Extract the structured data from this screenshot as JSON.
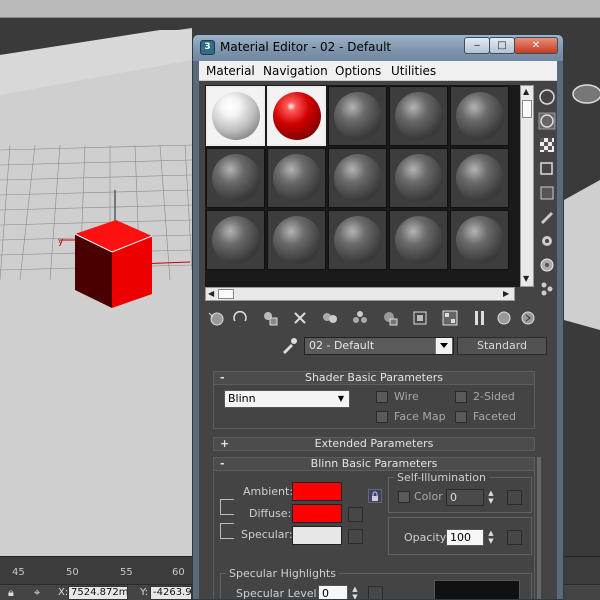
{
  "window": {
    "title": "Material Editor - 02 - Default"
  },
  "menu": [
    "Material",
    "Navigation",
    "Options",
    "Utilities"
  ],
  "material": {
    "name": "02 - Default",
    "type": "Standard"
  },
  "rollouts": {
    "shader_basic": {
      "title": "Shader Basic Parameters",
      "sign": "-",
      "shader": "Blinn",
      "wire_label": "Wire",
      "two_sided_label": "2-Sided",
      "face_map_label": "Face Map",
      "faceted_label": "Faceted"
    },
    "extended": {
      "title": "Extended Parameters",
      "sign": "+"
    },
    "blinn_basic": {
      "title": "Blinn Basic Parameters",
      "sign": "-",
      "ambient_label": "Ambient:",
      "diffuse_label": "Diffuse:",
      "specular_label": "Specular:",
      "ambient_color": "#ff0000",
      "diffuse_color": "#ff0000",
      "specular_color": "#e6e6e6",
      "self_illum_title": "Self-Illumination",
      "color_label": "Color",
      "self_illum_value": "0",
      "opacity_label": "Opacity:",
      "opacity_value": "100",
      "specular_highlights_title": "Specular Highlights",
      "specular_level_label": "Specular Level:",
      "specular_level_value": "0"
    }
  },
  "timeline": {
    "ticks": [
      "45",
      "50",
      "55",
      "60"
    ]
  },
  "status": {
    "x_label": "X:",
    "x_value": "7524.872m",
    "y_label": "Y:",
    "y_value": "-4263.9"
  },
  "colors": {
    "titlebar": "#8fa6bc",
    "panel": "#444444",
    "accent_red": "#ff0000"
  }
}
